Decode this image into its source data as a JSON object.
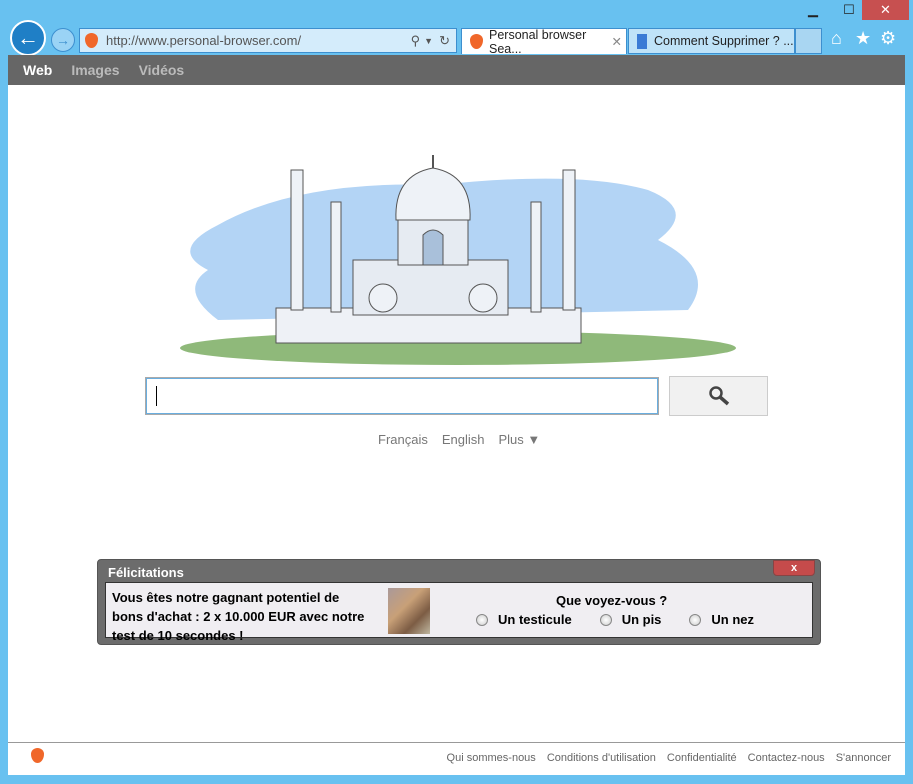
{
  "window": {
    "minimize": "▁",
    "maximize": "☐",
    "close": "✕"
  },
  "browser": {
    "url": "http://www.personal-browser.com/",
    "tabs": [
      {
        "label": "Personal browser Sea...",
        "close": "✕"
      },
      {
        "label": "Comment Supprimer ? ..."
      }
    ]
  },
  "nav": {
    "items": [
      "Web",
      "Images",
      "Vidéos"
    ]
  },
  "search": {
    "value": "",
    "button_icon": "search-icon"
  },
  "langs": {
    "items": [
      "Français",
      "English",
      "Plus ▼"
    ]
  },
  "popup": {
    "title": "Félicitations",
    "close": "x",
    "text": "Vous êtes notre gagnant potentiel de bons d'achat : 2 x 10.000 EUR avec notre test de 10 secondes !",
    "question": "Que voyez-vous ?",
    "options": [
      "Un testicule",
      "Un pis",
      "Un nez"
    ]
  },
  "footer": {
    "links": [
      "Qui sommes-nous",
      "Conditions d'utilisation",
      "Confidentialité",
      "Contactez-nous",
      "S'annoncer"
    ]
  },
  "colors": {
    "frame": "#68c1f0",
    "accent": "#f0672a",
    "nav": "#666666"
  }
}
